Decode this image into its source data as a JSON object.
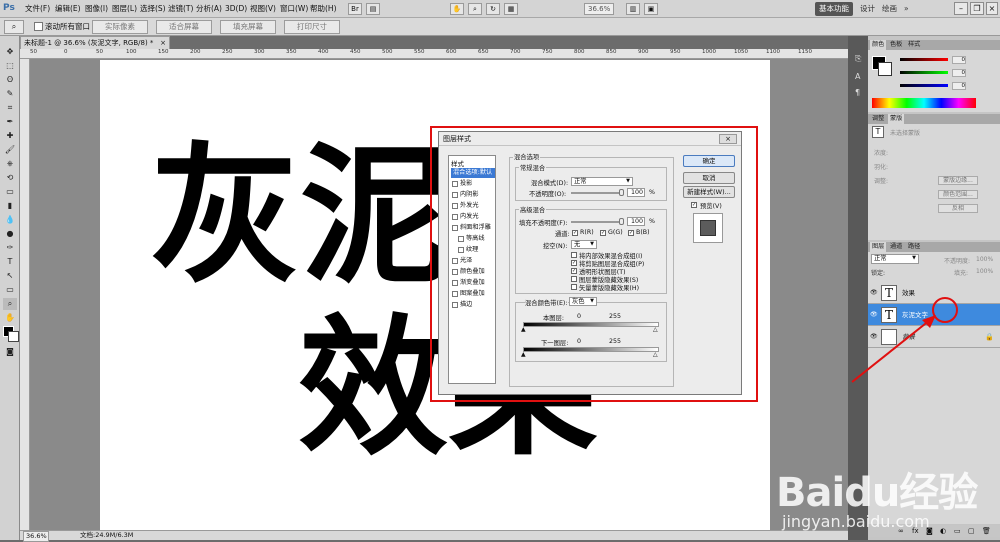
{
  "app": {
    "logo": "Ps"
  },
  "menubar": {
    "items": [
      "文件(F)",
      "编辑(E)",
      "图像(I)",
      "图层(L)",
      "选择(S)",
      "滤镜(T)",
      "分析(A)",
      "3D(D)",
      "视图(V)",
      "窗口(W)",
      "帮助(H)"
    ],
    "zoom": "36.6%",
    "workspace_active": "基本功能",
    "workspace_links": [
      "设计",
      "绘画",
      "»"
    ],
    "cs_live": "CS Live"
  },
  "optionsbar": {
    "scroll_all_label": "滚动所有窗口",
    "buttons": [
      "实际像素",
      "适合屏幕",
      "填充屏幕",
      "打印尺寸"
    ]
  },
  "document": {
    "tab_title": "未标题-1 @ 36.6% (灰泥文字, RGB/8) *",
    "text_chars": [
      "灰",
      "泥",
      "效",
      "果"
    ],
    "ruler_top": [
      "50",
      "0",
      "50",
      "100",
      "150",
      "200",
      "250",
      "300",
      "350",
      "400",
      "450",
      "500",
      "550",
      "600",
      "650",
      "700",
      "750",
      "800",
      "850",
      "900",
      "950",
      "1000",
      "1050",
      "1100",
      "1150"
    ],
    "status_zoom": "36.6%",
    "status_doc": "文档:24.9M/6.3M"
  },
  "dialog": {
    "title": "图层样式",
    "styles_header": "样式",
    "styles": [
      {
        "label": "混合选项:默认",
        "selected": true
      },
      {
        "label": "投影"
      },
      {
        "label": "内阴影"
      },
      {
        "label": "外发光"
      },
      {
        "label": "内发光"
      },
      {
        "label": "斜面和浮雕"
      },
      {
        "label": "等高线",
        "sub": true
      },
      {
        "label": "纹理",
        "sub": true
      },
      {
        "label": "光泽"
      },
      {
        "label": "颜色叠加"
      },
      {
        "label": "渐变叠加"
      },
      {
        "label": "图案叠加"
      },
      {
        "label": "描边"
      }
    ],
    "blend": {
      "section": "混合选项",
      "general": "常规混合",
      "mode_label": "混合模式(D):",
      "mode_value": "正常",
      "opacity_label": "不透明度(O):",
      "opacity_value": "100",
      "pct": "%"
    },
    "advanced": {
      "section": "高级混合",
      "fill_label": "填充不透明度(F):",
      "fill_value": "100",
      "pct": "%",
      "channels_label": "通道:",
      "channels": [
        "R(R)",
        "G(G)",
        "B(B)"
      ],
      "knockout_label": "挖空(N):",
      "knockout_value": "无",
      "options": [
        {
          "label": "将内部效果混合成组(I)",
          "checked": false
        },
        {
          "label": "将剪贴图层混合成组(P)",
          "checked": true
        },
        {
          "label": "透明形状图层(T)",
          "checked": true
        },
        {
          "label": "图层蒙版隐藏效果(S)",
          "checked": false
        },
        {
          "label": "矢量蒙版隐藏效果(H)",
          "checked": false
        }
      ]
    },
    "blend_if": {
      "label": "混合颜色带(E):",
      "value": "灰色",
      "this_layer": "本图层:",
      "underlying": "下一图层:",
      "min": "0",
      "max": "255"
    },
    "buttons": {
      "ok": "确定",
      "cancel": "取消",
      "new_style": "新建样式(W)...",
      "preview": "预览(V)"
    }
  },
  "panels": {
    "color_tabs": [
      "颜色",
      "色板",
      "样式"
    ],
    "color_values": [
      "0",
      "0",
      "0"
    ],
    "adjust_tabs": [
      "调整",
      "蒙版"
    ],
    "mask_label": "未选择蒙版",
    "mask_fields": [
      "浓度:",
      "羽化:",
      "调整:"
    ],
    "mask_buttons": [
      "蒙版边缘...",
      "颜色范围...",
      "反相"
    ],
    "layers_tabs": [
      "图层",
      "通道",
      "路径"
    ],
    "layer_mode": "正常",
    "layer_opacity_label": "不透明度:",
    "layer_opacity": "100%",
    "lock_label": "锁定:",
    "fill_label": "填充:",
    "fill_value": "100%",
    "layers": [
      {
        "name": "效果",
        "thumb": "T",
        "selected": false
      },
      {
        "name": "灰泥文字",
        "thumb": "T",
        "selected": true
      },
      {
        "name": "背景",
        "thumb": "",
        "selected": false
      }
    ]
  },
  "watermark": {
    "brand": "Baidu经验",
    "url": "jingyan.baidu.com"
  },
  "colors": {
    "accent": "#3e8ade",
    "highlight": "#e01010"
  }
}
